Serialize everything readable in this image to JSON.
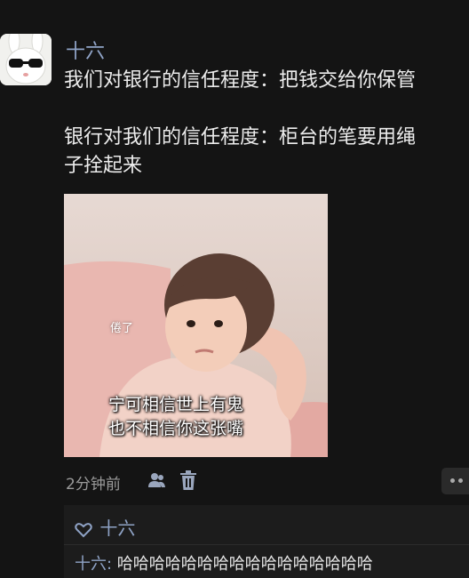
{
  "post": {
    "author": "十六",
    "lines": [
      "我们对银行的信任程度：把钱交给你保管",
      "银行对我们的信任程度：柜台的笔要用绳",
      "子拴起来"
    ],
    "image": {
      "small_caption": "倦了",
      "caption_line1": "宁可相信世上有鬼",
      "caption_line2": "也不相信你这张嘴"
    },
    "timestamp": "2分钟前"
  },
  "icons": {
    "avatar": "bunny-sunglasses-avatar",
    "people": "people-icon",
    "delete": "trash-icon",
    "more": "more-icon",
    "like": "heart-outline-icon"
  },
  "interactions": {
    "likes": "十六",
    "comments": [
      {
        "author": "十六",
        "separator": ": ",
        "text": "哈哈哈哈哈哈哈哈哈哈哈哈哈哈哈哈"
      }
    ]
  },
  "colors": {
    "background": "#141414",
    "name_blue": "#8fa3c6",
    "panel": "#1c1c1c"
  }
}
